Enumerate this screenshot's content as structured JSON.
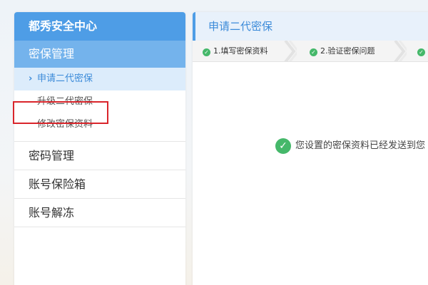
{
  "sidebar": {
    "header": "都秀安全中心",
    "section": "密保管理",
    "sub_items": [
      {
        "label": "申请二代密保",
        "active": true
      },
      {
        "label": "升级二代密保",
        "active": false
      },
      {
        "label": "修改密保资料",
        "active": false,
        "highlighted": true
      }
    ],
    "items": [
      {
        "label": "密码管理"
      },
      {
        "label": "账号保险箱"
      },
      {
        "label": "账号解冻"
      }
    ]
  },
  "main": {
    "title": "申请二代密保",
    "steps": [
      {
        "label": "1.填写密保资料",
        "done": true
      },
      {
        "label": "2.验证密保问题",
        "done": true
      },
      {
        "label": "",
        "done": true
      }
    ],
    "message": "您设置的密保资料已经发送到您"
  },
  "colors": {
    "accent": "#4e9de6",
    "section_bg": "#74b3ec",
    "active_bg": "#dcecfb",
    "highlight": "#d9252b",
    "success": "#45b86a"
  }
}
